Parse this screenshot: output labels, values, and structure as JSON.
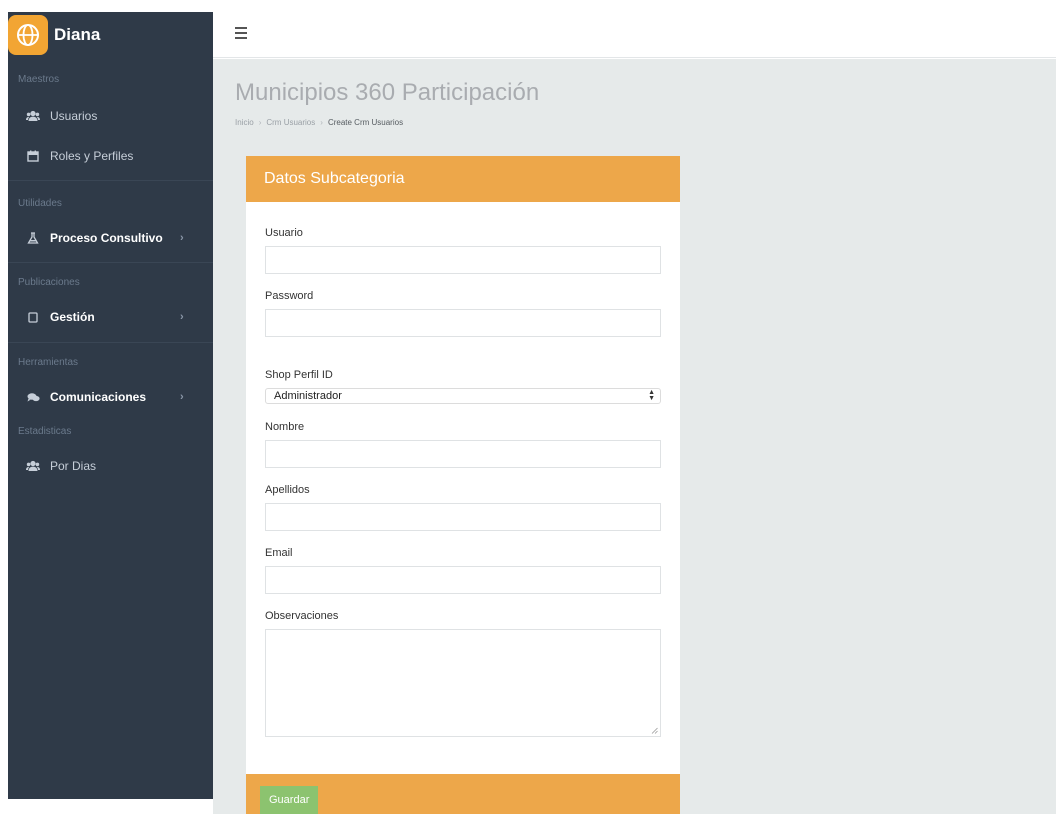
{
  "brand": {
    "name": "Diana"
  },
  "sidebar": {
    "sections": [
      {
        "label": "Maestros",
        "items": [
          {
            "label": "Usuarios",
            "icon": "users-icon"
          },
          {
            "label": "Roles y Perfiles",
            "icon": "calendar-icon"
          }
        ]
      },
      {
        "label": "Utilidades",
        "items": [
          {
            "label": "Proceso Consultivo",
            "icon": "flask-icon"
          }
        ]
      },
      {
        "label": "Publicaciones",
        "items": [
          {
            "label": "Gestión",
            "icon": "tablet-icon"
          }
        ]
      },
      {
        "label": "Herramientas",
        "items": [
          {
            "label": "Comunicaciones",
            "icon": "comments-icon"
          }
        ]
      },
      {
        "label": "Estadisticas",
        "items": [
          {
            "label": "Por Dias",
            "icon": "users-icon"
          }
        ]
      }
    ]
  },
  "header": {
    "title": "Municipios 360 Participación"
  },
  "breadcrumb": {
    "items": [
      "Inicio",
      "Crm Usuarios",
      "Create Crm Usuarios"
    ]
  },
  "form": {
    "title": "Datos Subcategoria",
    "usuario_label": "Usuario",
    "usuario_value": "",
    "password_label": "Password",
    "password_value": "",
    "perfil_label": "Shop Perfil ID",
    "perfil_selected": "Administrador",
    "nombre_label": "Nombre",
    "nombre_value": "",
    "apellidos_label": "Apellidos",
    "apellidos_value": "",
    "email_label": "Email",
    "email_value": "",
    "observaciones_label": "Observaciones",
    "observaciones_value": "",
    "save_label": "Guardar"
  },
  "colors": {
    "sidebar": "#2f3a48",
    "accent": "#eda74a",
    "logo": "#f2a533",
    "save": "#8cc36f",
    "content_bg": "#e6eaea"
  }
}
